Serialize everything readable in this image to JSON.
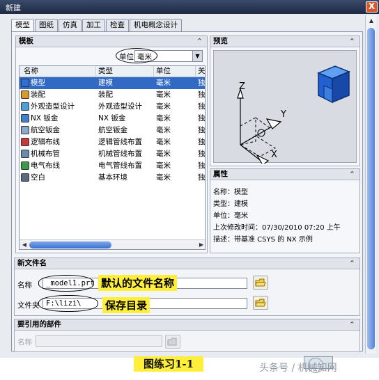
{
  "window": {
    "title": "新建",
    "close_glyph": "X"
  },
  "tabs": [
    {
      "label": "模型",
      "active": true
    },
    {
      "label": "图纸",
      "active": false
    },
    {
      "label": "仿真",
      "active": false
    },
    {
      "label": "加工",
      "active": false
    },
    {
      "label": "检查",
      "active": false
    },
    {
      "label": "机电概念设计",
      "active": false
    }
  ],
  "template": {
    "title": "模板",
    "units_label": "单位",
    "units_value": "毫米",
    "columns": [
      "名称",
      "类型",
      "单位",
      "关"
    ],
    "rows": [
      {
        "name": "模型",
        "type": "建模",
        "unit": "毫米",
        "rel": "独",
        "icon": "model-icon",
        "selected": true
      },
      {
        "name": "装配",
        "type": "装配",
        "unit": "毫米",
        "rel": "独",
        "icon": "assembly-icon"
      },
      {
        "name": "外观造型设计",
        "type": "外观造型设计",
        "unit": "毫米",
        "rel": "独",
        "icon": "shape-studio-icon"
      },
      {
        "name": "NX 钣金",
        "type": "NX 钣金",
        "unit": "毫米",
        "rel": "独",
        "icon": "sheet-metal-icon"
      },
      {
        "name": "航空钣金",
        "type": "航空钣金",
        "unit": "毫米",
        "rel": "独",
        "icon": "aero-sheet-metal-icon"
      },
      {
        "name": "逻辑布线",
        "type": "逻辑管线布置",
        "unit": "毫米",
        "rel": "独",
        "icon": "logical-routing-icon"
      },
      {
        "name": "机械布管",
        "type": "机械管线布置",
        "unit": "毫米",
        "rel": "独",
        "icon": "mechanical-routing-icon"
      },
      {
        "name": "电气布线",
        "type": "电气管线布置",
        "unit": "毫米",
        "rel": "独",
        "icon": "electrical-routing-icon"
      },
      {
        "name": "空白",
        "type": "基本环境",
        "unit": "毫米",
        "rel": "独",
        "icon": "blank-icon"
      }
    ]
  },
  "preview": {
    "title": "预览",
    "axis_x": "X",
    "axis_y": "Y",
    "axis_z": "Z"
  },
  "properties": {
    "title": "属性",
    "items": [
      "名称：模型",
      "类型：建模",
      "单位：毫米",
      "上次修改时间：07/30/2010 07:20 上午",
      "描述：带基准 CSYS 的 NX 示例"
    ]
  },
  "new_file": {
    "title": "新文件名",
    "name_label": "名称",
    "name_value": "_model1.prt",
    "folder_label": "文件夹",
    "folder_value": "F:\\lizi\\",
    "annotation_name": "默认的文件名称",
    "annotation_folder": "保存目录"
  },
  "referenced_parts": {
    "title": "要引用的部件",
    "name_label": "名称",
    "name_value": ""
  },
  "caption": "图练习1-1",
  "watermark": "头条号 / 机械知网",
  "colors": {
    "selection": "#316ac5",
    "highlight": "#ffef3a",
    "titlebar": "#1e2a44"
  }
}
